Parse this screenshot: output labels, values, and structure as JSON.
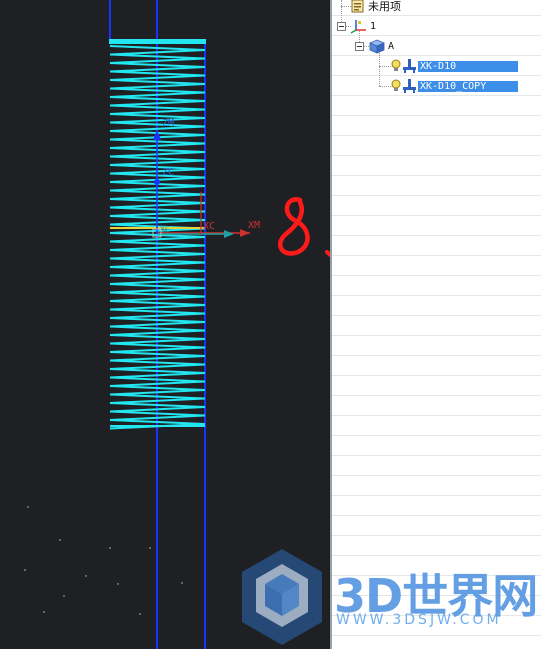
{
  "viewport": {
    "background": "#1f2024",
    "coil_color": "#22e6f0",
    "axis_color": "#1633ff",
    "handwritten_annotation": "8、5",
    "handwriting_color": "#ff1a1a",
    "axis_labels": {
      "zm": "ZM",
      "zc": "ZC",
      "xc": "XC",
      "xm": "XM",
      "yc": "YC"
    }
  },
  "navigator": {
    "nodes": [
      {
        "label": "未用项",
        "icon": "unused-items-icon",
        "selected": false
      },
      {
        "label": "1",
        "icon": "wcs-axes-icon",
        "selected": false
      },
      {
        "label": "A",
        "icon": "cube-body-icon",
        "selected": false
      },
      {
        "label": "XK-D10",
        "icon": "tool-holder-icon",
        "selected": true
      },
      {
        "label": "XK-D10_COPY",
        "icon": "tool-holder-icon",
        "selected": true
      }
    ],
    "selection_color": "#3d8ee8"
  },
  "watermark": {
    "text": "3D世界网",
    "url": "WWW.3DSJW.COM"
  }
}
